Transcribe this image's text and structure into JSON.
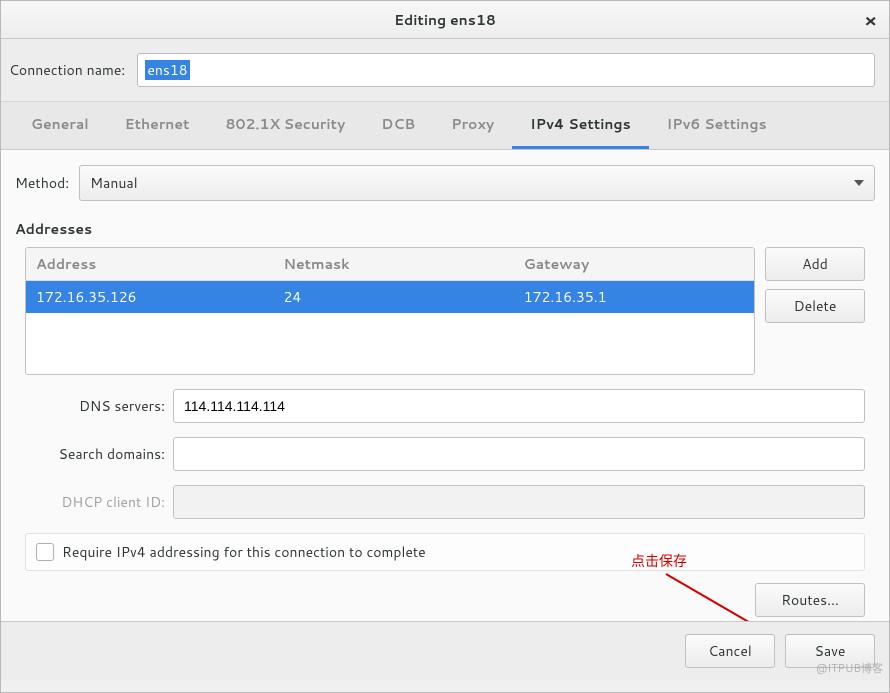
{
  "titlebar": {
    "title": "Editing ens18"
  },
  "connection": {
    "label": "Connection name:",
    "value": "ens18"
  },
  "tabs": {
    "general": "General",
    "ethernet": "Ethernet",
    "security": "802.1X Security",
    "dcb": "DCB",
    "proxy": "Proxy",
    "ipv4": "IPv4 Settings",
    "ipv6": "IPv6 Settings"
  },
  "method": {
    "label": "Method:",
    "value": "Manual"
  },
  "addresses": {
    "title": "Addresses",
    "headers": {
      "address": "Address",
      "netmask": "Netmask",
      "gateway": "Gateway"
    },
    "rows": [
      {
        "address": "172.16.35.126",
        "netmask": "24",
        "gateway": "172.16.35.1"
      }
    ],
    "add": "Add",
    "delete": "Delete"
  },
  "dns": {
    "label": "DNS servers:",
    "value": "114.114.114.114"
  },
  "search": {
    "label": "Search domains:",
    "value": ""
  },
  "dhcp": {
    "label": "DHCP client ID:",
    "value": ""
  },
  "require": {
    "label": "Require IPv4 addressing for this connection to complete"
  },
  "routes": {
    "label": "Routes..."
  },
  "footer": {
    "cancel": "Cancel",
    "save": "Save"
  },
  "annotation": {
    "text": "点击保存"
  },
  "watermark": "@ITPUB博客"
}
